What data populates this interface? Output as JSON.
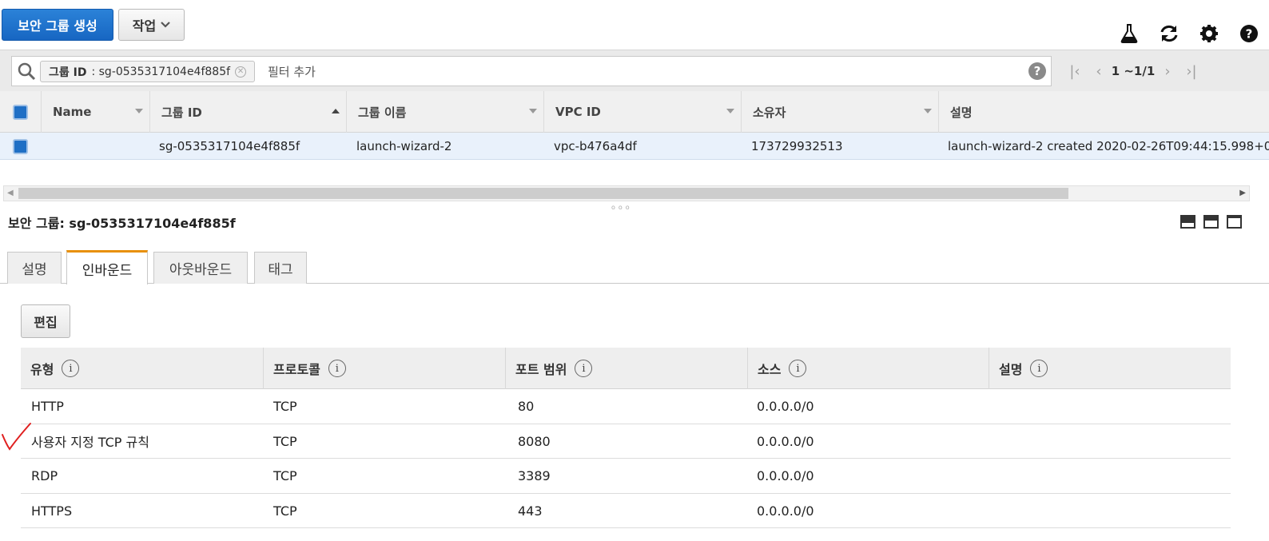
{
  "toolbar": {
    "create_label": "보안 그룹 생성",
    "actions_label": "작업",
    "icons": [
      "flask-icon",
      "refresh-icon",
      "gear-icon",
      "help-icon"
    ]
  },
  "filter": {
    "chip_key": "그룹 ID",
    "chip_value": ": sg-0535317104e4f885f",
    "placeholder": "필터 추가",
    "pagination": "1 ~1/1"
  },
  "grid": {
    "columns": [
      "Name",
      "그룹 ID",
      "그룹 이름",
      "VPC ID",
      "소유자",
      "설명"
    ],
    "rows": [
      {
        "name": "",
        "group_id": "sg-0535317104e4f885f",
        "group_name": "launch-wizard-2",
        "vpc_id": "vpc-b476a4df",
        "owner": "173729932513",
        "description": "launch-wizard-2 created 2020-02-26T09:44:15.998+0"
      }
    ]
  },
  "detail": {
    "title": "보안 그룹: sg-0535317104e4f885f",
    "tabs": [
      "설명",
      "인바운드",
      "아웃바운드",
      "태그"
    ],
    "active_tab": "인바운드",
    "edit_label": "편집",
    "rule_columns": [
      "유형",
      "프로토콜",
      "포트 범위",
      "소스",
      "설명"
    ],
    "rules": [
      {
        "type": "HTTP",
        "protocol": "TCP",
        "port": "80",
        "source": "0.0.0.0/0",
        "description": ""
      },
      {
        "type": "사용자 지정 TCP 규칙",
        "protocol": "TCP",
        "port": "8080",
        "source": "0.0.0.0/0",
        "description": ""
      },
      {
        "type": "RDP",
        "protocol": "TCP",
        "port": "3389",
        "source": "0.0.0.0/0",
        "description": ""
      },
      {
        "type": "HTTPS",
        "protocol": "TCP",
        "port": "443",
        "source": "0.0.0.0/0",
        "description": ""
      }
    ]
  },
  "colors": {
    "primary": "#1f6fc5",
    "active_tab_accent": "#e8900c",
    "selected_row": "#e9f1fb",
    "annotation_mark": "#e02020"
  }
}
